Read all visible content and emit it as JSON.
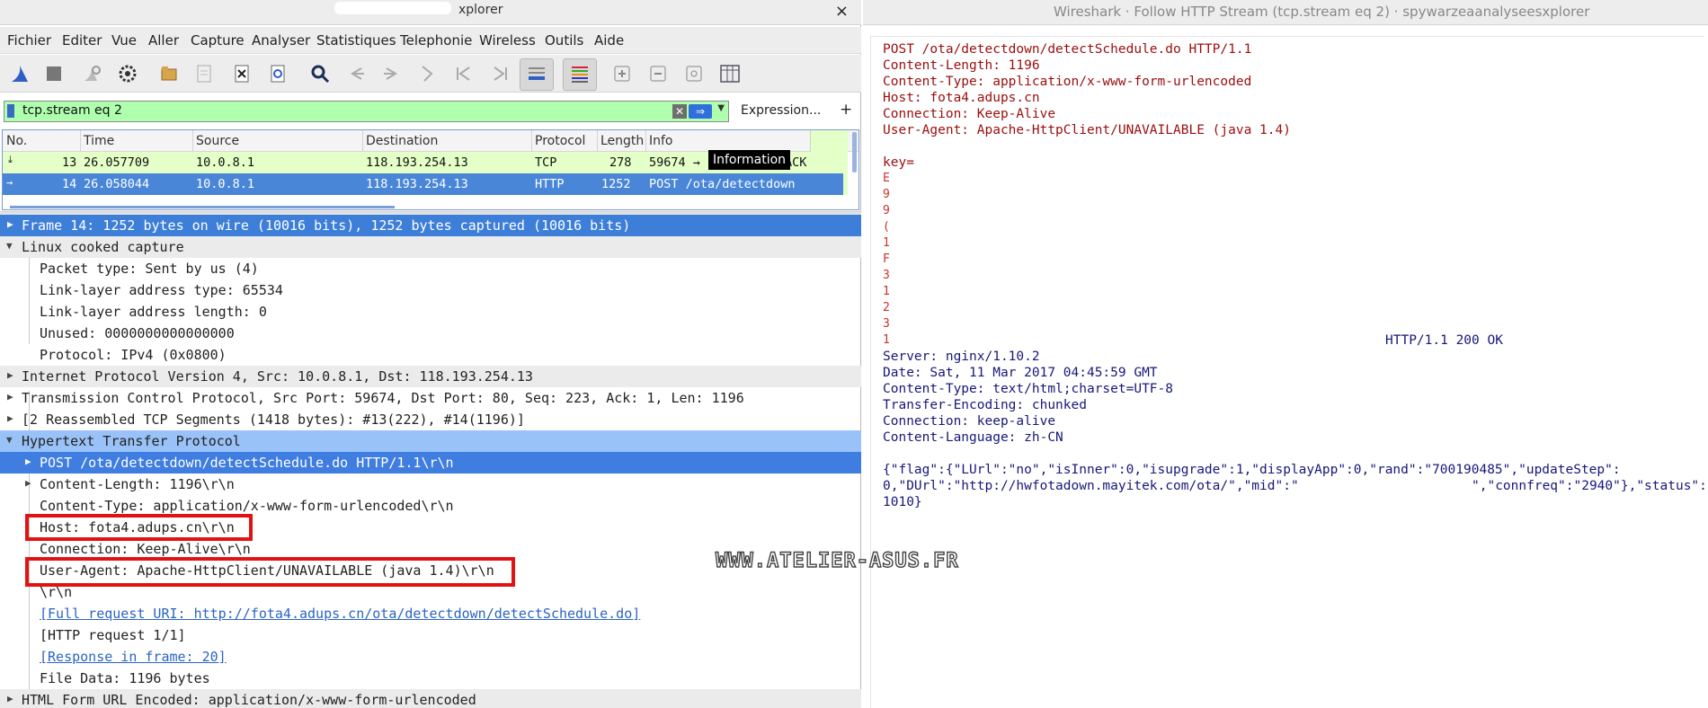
{
  "left_window": {
    "title_fragment": "xplorer",
    "close": "×",
    "menu": [
      "Fichier",
      "Editer",
      "Vue",
      "Aller",
      "Capture",
      "Analyser",
      "Statistiques",
      "Telephonie",
      "Wireless",
      "Outils",
      "Aide"
    ],
    "toolbar_icons": [
      "shark-fin-icon",
      "stop-icon",
      "restart-icon",
      "options-gear-icon",
      "open-file-icon",
      "save-file-icon",
      "close-file-icon",
      "reload-icon",
      "find-icon",
      "back-icon",
      "forward-icon",
      "goto-packet-icon",
      "first-packet-icon",
      "last-packet-icon",
      "autoscroll-icon",
      "colorize-icon",
      "zoom-in-icon",
      "zoom-out-icon",
      "normal-size-icon",
      "resize-columns-icon"
    ],
    "filter": {
      "value": "tcp.stream eq 2",
      "clear": "✕",
      "apply": "⇒",
      "expression_label": "Expression...",
      "plus": "+"
    },
    "packet_list": {
      "columns": [
        "No.",
        "Time",
        "Source",
        "Destination",
        "Protocol",
        "Length",
        "Info"
      ],
      "rows": [
        {
          "no": "13",
          "time": "26.057709",
          "source": "10.0.8.1",
          "destination": "118.193.254.13",
          "protocol": "TCP",
          "length": "278",
          "info": "59674 →",
          "info_tail": "ACK"
        },
        {
          "no": "14",
          "time": "26.058044",
          "source": "10.0.8.1",
          "destination": "118.193.254.13",
          "protocol": "HTTP",
          "length": "1252",
          "info": "POST /ota/detectdown"
        }
      ],
      "tooltip": "Information"
    },
    "details": [
      {
        "text": "Frame 14: 1252 bytes on wire (10016 bits), 1252 bytes captured (10016 bits)",
        "level": 0,
        "arrow": "right"
      },
      {
        "text": "Linux cooked capture",
        "level": 0,
        "arrow": "down"
      },
      {
        "text": "Packet type: Sent by us (4)",
        "level": 1
      },
      {
        "text": "Link-layer address type: 65534",
        "level": 1
      },
      {
        "text": "Link-layer address length: 0",
        "level": 1
      },
      {
        "text": "Unused: 0000000000000000",
        "level": 1
      },
      {
        "text": "Protocol: IPv4 (0x0800)",
        "level": 1
      },
      {
        "text": "Internet Protocol Version 4, Src: 10.0.8.1, Dst: 118.193.254.13",
        "level": 0,
        "arrow": "right"
      },
      {
        "text": "Transmission Control Protocol, Src Port: 59674, Dst Port: 80, Seq: 223, Ack: 1, Len: 1196",
        "level": 0,
        "arrow": "right"
      },
      {
        "text": "[2 Reassembled TCP Segments (1418 bytes): #13(222), #14(1196)]",
        "level": 0,
        "arrow": "right"
      },
      {
        "text": "Hypertext Transfer Protocol",
        "level": 0,
        "arrow": "down"
      },
      {
        "text": "POST /ota/detectdown/detectSchedule.do HTTP/1.1\\r\\n",
        "level": 1,
        "arrow": "right"
      },
      {
        "text": "Content-Length: 1196\\r\\n",
        "level": 1,
        "arrow": "right"
      },
      {
        "text": "Content-Type: application/x-www-form-urlencoded\\r\\n",
        "level": 1
      },
      {
        "text": "Host: fota4.adups.cn\\r\\n",
        "level": 1
      },
      {
        "text": "Connection: Keep-Alive\\r\\n",
        "level": 1
      },
      {
        "text": "User-Agent: Apache-HttpClient/UNAVAILABLE (java 1.4)\\r\\n",
        "level": 1
      },
      {
        "text": "\\r\\n",
        "level": 1
      },
      {
        "text": "[Full request URI: http://fota4.adups.cn/ota/detectdown/detectSchedule.do]",
        "level": 1,
        "link": true
      },
      {
        "text": "[HTTP request 1/1]",
        "level": 1
      },
      {
        "text": "[Response in frame: 20]",
        "level": 1,
        "link": true
      },
      {
        "text": "File Data: 1196 bytes",
        "level": 1
      },
      {
        "text": "HTML Form URL Encoded: application/x-www-form-urlencoded",
        "level": 0,
        "arrow": "right"
      }
    ]
  },
  "right_window": {
    "title": "Wireshark · Follow HTTP Stream (tcp.stream eq 2) · spywarzeaanalyseesxplorer",
    "request_lines": [
      "POST /ota/detectdown/detectSchedule.do HTTP/1.1",
      "Content-Length: 1196",
      "Content-Type: application/x-www-form-urlencoded",
      "Host: fota4.adups.cn",
      "Connection: Keep-Alive",
      "User-Agent: Apache-HttpClient/UNAVAILABLE (java 1.4)"
    ],
    "body_key": "key=",
    "body_fragments": [
      "E",
      "9",
      "9",
      "(",
      "1",
      "F",
      "3",
      "1",
      "2",
      "3",
      "1"
    ],
    "response_status": "HTTP/1.1 200 OK",
    "response_lines": [
      "Server: nginx/1.10.2",
      "Date: Sat, 11 Mar 2017 04:45:59 GMT",
      "Content-Type: text/html;charset=UTF-8",
      "Transfer-Encoding: chunked",
      "Connection: keep-alive",
      "Content-Language: zh-CN"
    ],
    "json_lines": [
      "{\"flag\":{\"LUrl\":\"no\",\"isInner\":0,\"isupgrade\":1,\"displayApp\":0,\"rand\":\"700190485\",\"updateStep\":",
      "0,\"DUrl\":\"http://hwfotadown.mayitek.com/ota/\",\"mid\":\"",
      "\",\"connfreq\":\"2940\"},\"status\":",
      "1010}"
    ]
  },
  "watermark": "WWW.ATELIER-ASUS.FR",
  "colors": {
    "selected_row": "#3d7fd8",
    "packet_tcp_row": "#e4ffc7",
    "filter_valid": "#afffaf",
    "highlight_box": "#e31212",
    "request_text": "#9a0e0e",
    "response_text": "#17177a"
  }
}
